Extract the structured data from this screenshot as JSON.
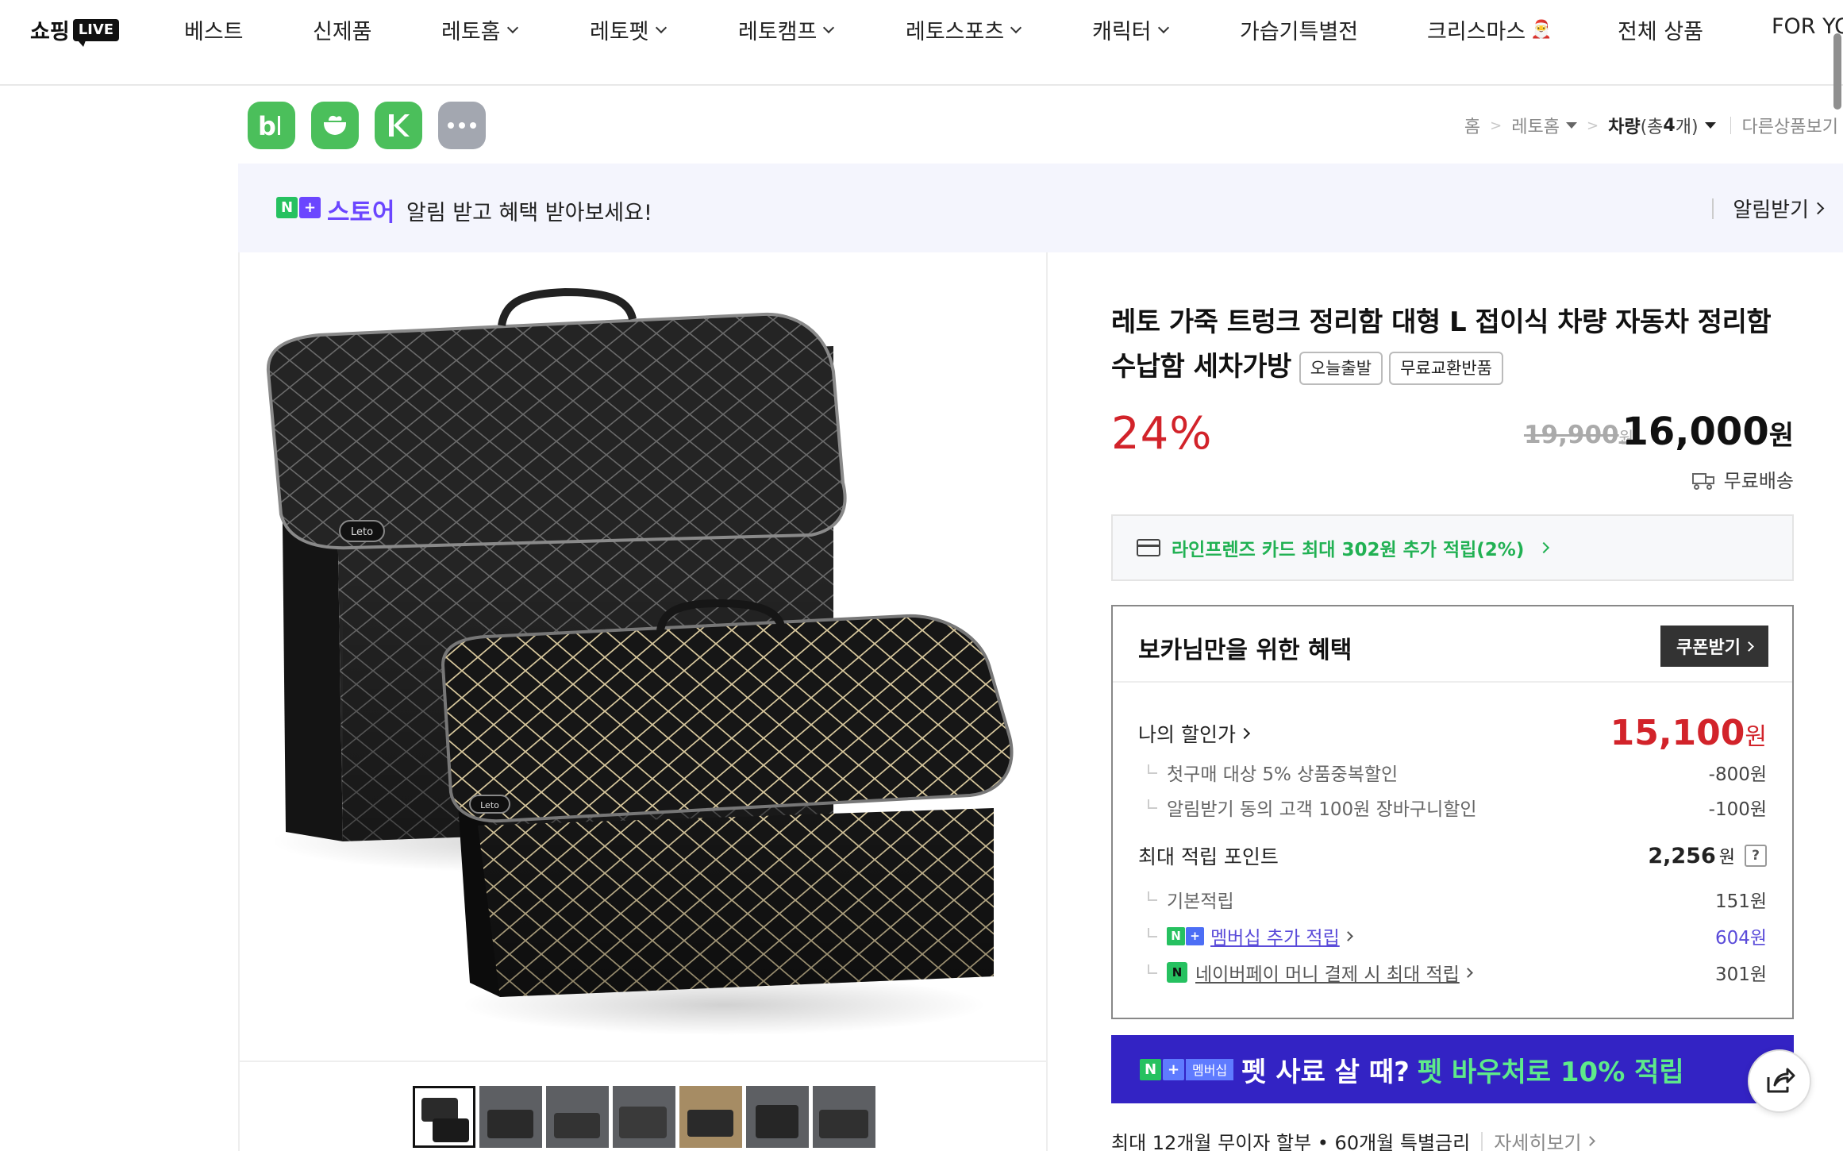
{
  "nav": {
    "logo_text": "쇼핑",
    "logo_badge": "LIVE",
    "items": [
      {
        "label": "베스트",
        "dropdown": false
      },
      {
        "label": "신제품",
        "dropdown": false
      },
      {
        "label": "레토홈",
        "dropdown": true
      },
      {
        "label": "레토펫",
        "dropdown": true
      },
      {
        "label": "레토캠프",
        "dropdown": true
      },
      {
        "label": "레토스포츠",
        "dropdown": true
      },
      {
        "label": "캐릭터",
        "dropdown": true
      },
      {
        "label": "가습기특별전",
        "dropdown": false
      },
      {
        "label": "크리스마스",
        "dropdown": false
      },
      {
        "label": "전체 상품",
        "dropdown": false
      },
      {
        "label": "FOR YO",
        "dropdown": false
      }
    ]
  },
  "apps": [
    "b-icon",
    "cup-icon",
    "k-icon",
    "more-icon"
  ],
  "breadcrumb": {
    "home": "홈",
    "category": "레토홈",
    "current": "차량",
    "count_prefix": "(총 ",
    "count": "4",
    "count_suffix": "개)",
    "other": "다른상품보기"
  },
  "store": {
    "badge_n": "N",
    "badge_plus": "+",
    "label": "스토어",
    "message": "알림 받고 혜택 받아보세요!",
    "action": "알림받기"
  },
  "product": {
    "title": "레토 가죽 트렁크 정리함 대형 L 접이식 차량 자동차 정리함 수납함 세차가방",
    "tags": [
      "오늘출발",
      "무료교환반품"
    ],
    "discount": "24%",
    "original_price": "19,900",
    "price": "16,000",
    "currency": "원",
    "shipping": "무료배송",
    "card_offer": "라인프렌즈 카드 최대 302원 추가 적립(2%)",
    "thumbnail_count": 7,
    "logo_text": "Leto"
  },
  "benefit": {
    "title": "보카님만을 위한 혜택",
    "coupon": "쿠폰받기",
    "my_price_label": "나의 할인가",
    "my_price": "15,100",
    "discounts": [
      {
        "label": "첫구매 대상 5% 상품중복할인",
        "value": "-800원"
      },
      {
        "label": "알림받기 동의 고객 100원 장바구니할인",
        "value": "-100원"
      }
    ],
    "points_label": "최대 적립 포인트",
    "points": "2,256",
    "points_unit": "원",
    "help": "?",
    "basic_label": "기본적립",
    "basic_value": "151원",
    "member_label": "멤버십 추가 적립",
    "member_value": "604원",
    "npay_label": "네이버페이 머니 결제 시 최대 적립",
    "npay_value": "301원"
  },
  "member_banner": {
    "badge": "멤버십",
    "text1": "펫 사료 살 때?",
    "text2": "펫 바우처로 10% 적립"
  },
  "installment": {
    "text": "최대 12개월 무이자 할부 • 60개월 특별금리",
    "more": "자세히보기"
  },
  "colors": {
    "accent_red": "#d2232a",
    "naver_green": "#26c160",
    "store_purple": "#6b46ff",
    "member_navy": "#3323c4"
  }
}
